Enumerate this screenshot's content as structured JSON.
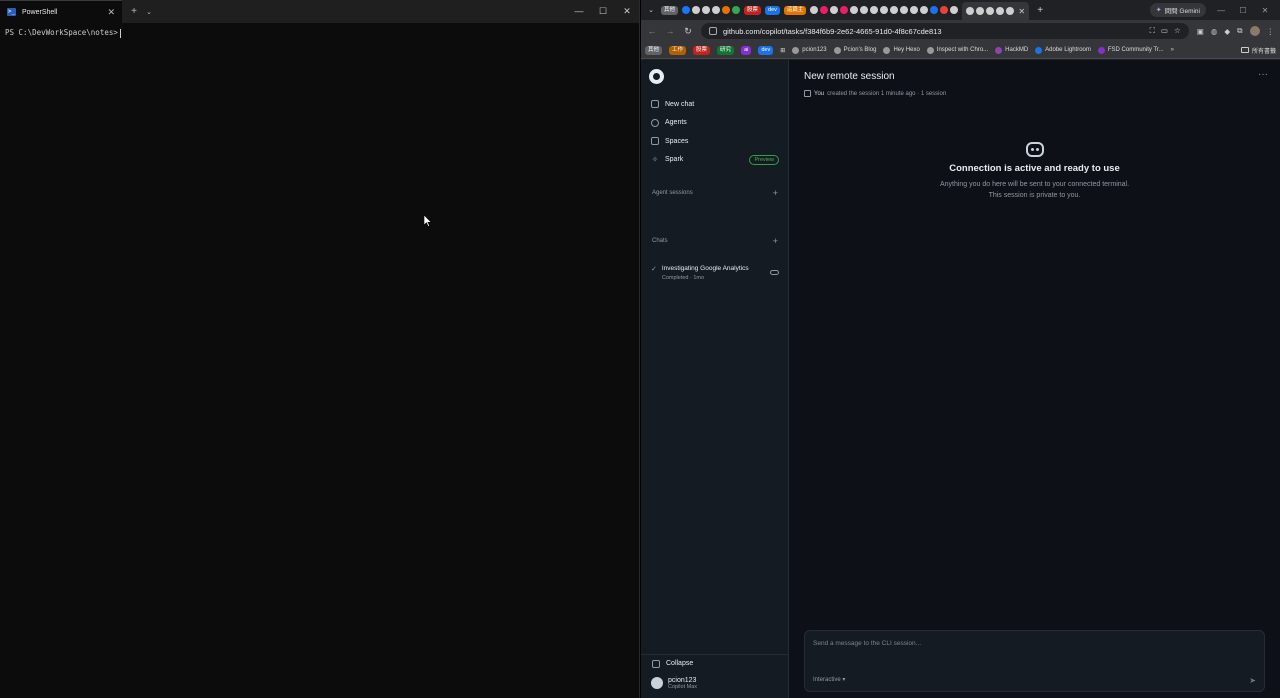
{
  "terminal": {
    "tab_title": "PowerShell",
    "prompt": "PS C:\\DevWorkSpace\\notes>"
  },
  "browser": {
    "tab_groups": [
      {
        "label": "其他",
        "color": "#5f6368"
      },
      {
        "label": "股票",
        "color": "#c5221f"
      },
      {
        "label": "dev",
        "color": "#1a73e8"
      },
      {
        "label": "這篇主",
        "color": "#e37400"
      }
    ],
    "gemini_label": "問問 Gemini",
    "url": "github.com/copilot/tasks/f384f6b9-2e62-4665-91d0-4f8c67cde813",
    "bookmarks": {
      "folders": [
        {
          "label": "其他",
          "color": "#5f6368"
        },
        {
          "label": "工作",
          "color": "#b06000"
        },
        {
          "label": "股票",
          "color": "#c5221f"
        },
        {
          "label": "研究",
          "color": "#137333"
        },
        {
          "label": "ai",
          "color": "#8430ce"
        },
        {
          "label": "dev",
          "color": "#1a73e8"
        }
      ],
      "links": [
        "pcion123",
        "Pcion's Blog",
        "Hey Hexo",
        "Inspect with Chro...",
        "HackMD",
        "Adobe Lightroom",
        "FSD Community Tr..."
      ],
      "all_bookmarks": "所有書籤"
    }
  },
  "copilot": {
    "nav": {
      "new_chat": "New chat",
      "agents": "Agents",
      "spaces": "Spaces",
      "spark": "Spark",
      "preview": "Preview"
    },
    "agent_sessions_label": "Agent sessions",
    "sessions": [
      {
        "title": "Investigating Google Analytics",
        "meta": "Completed · 1mo"
      }
    ],
    "chats_label": "Chats",
    "collapse_label": "Collapse",
    "user": {
      "name": "pcion123",
      "plan": "Copilot Max"
    },
    "main": {
      "title": "New remote session",
      "meta_you": "You",
      "meta_rest": "created the session 1 minute ago · 1 session",
      "ready_title": "Connection is active and ready to use",
      "ready_desc": "Anything you do here will be sent to your connected terminal. This session is private to you."
    },
    "composer": {
      "placeholder": "Send a message to the CLI session...",
      "mode": "Interactive"
    }
  }
}
